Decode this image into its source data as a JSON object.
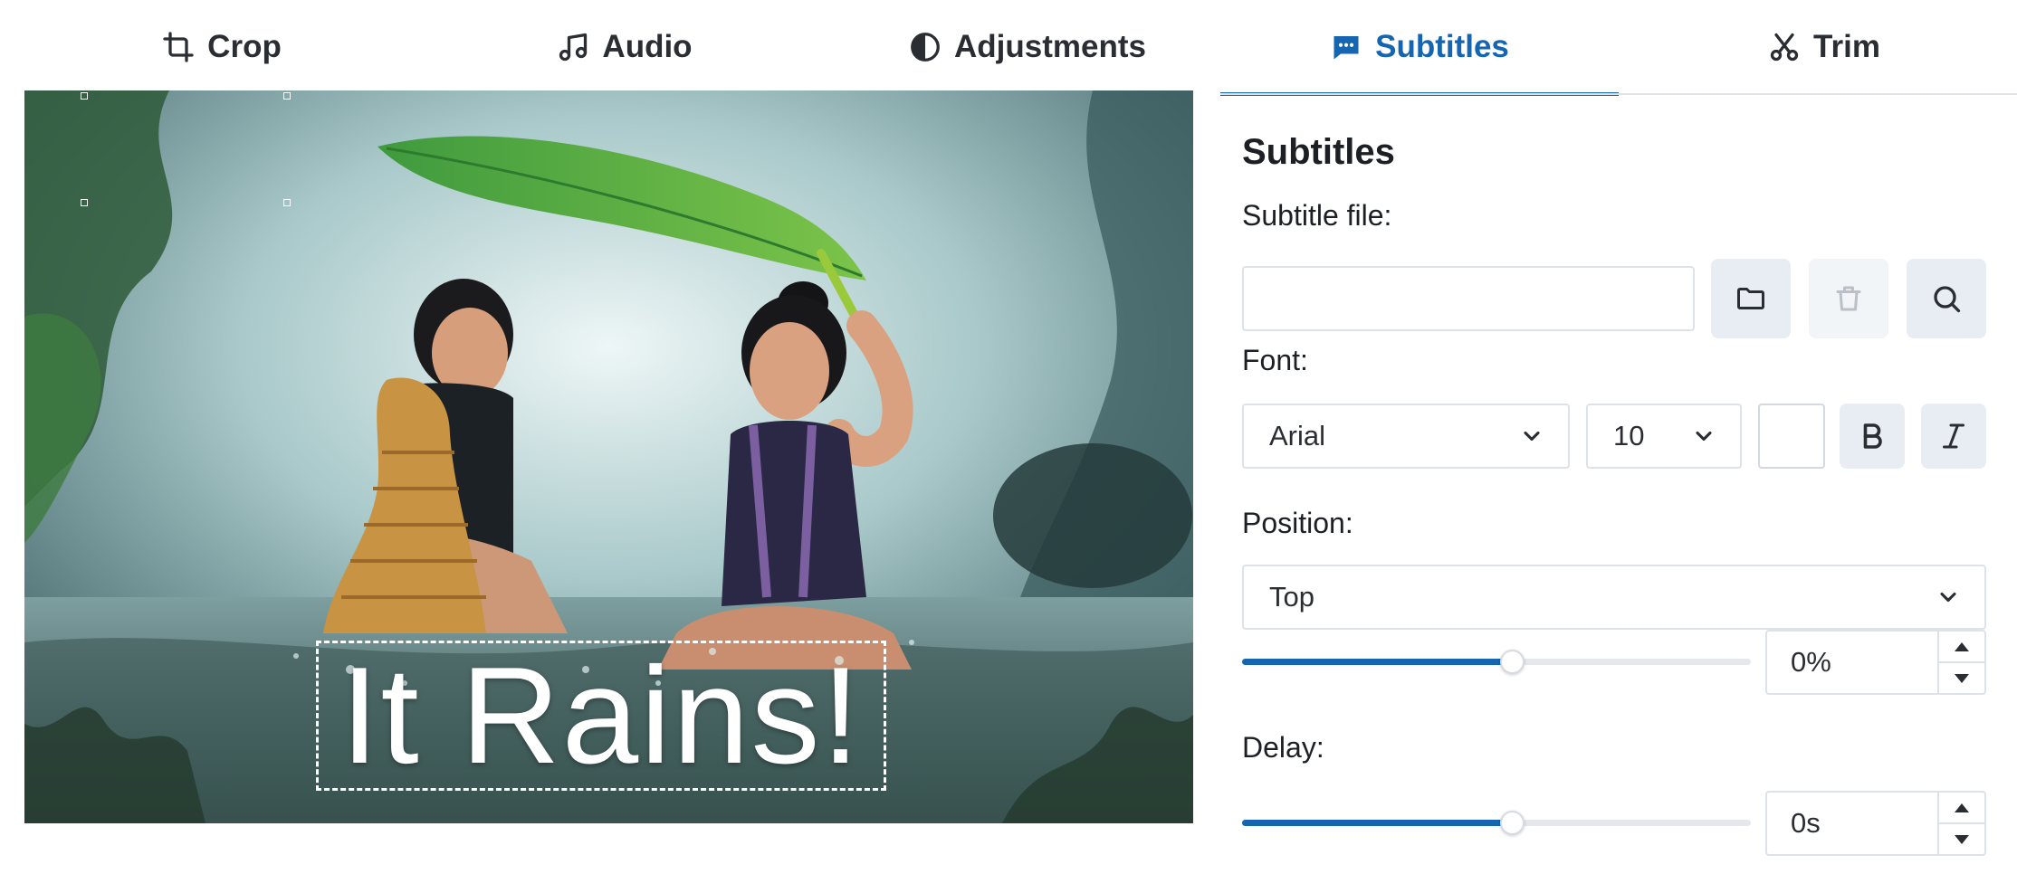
{
  "tabs": [
    {
      "id": "crop",
      "label": "Crop",
      "icon": "crop-icon"
    },
    {
      "id": "audio",
      "label": "Audio",
      "icon": "music-note-icon"
    },
    {
      "id": "adjustments",
      "label": "Adjustments",
      "icon": "contrast-icon"
    },
    {
      "id": "subtitles",
      "label": "Subtitles",
      "icon": "chat-bubble-icon",
      "active": true
    },
    {
      "id": "trim",
      "label": "Trim",
      "icon": "scissors-icon"
    }
  ],
  "preview": {
    "subtitle_text": "It Rains!"
  },
  "panel": {
    "title": "Subtitles",
    "subtitle_file_label": "Subtitle file:",
    "subtitle_file_value": "",
    "buttons": {
      "open": "folder-icon",
      "delete": "trash-icon",
      "preview": "search-icon"
    },
    "font_label": "Font:",
    "font_family_value": "Arial",
    "font_size_value": "10",
    "font_color": "#ffffff",
    "bold_icon": "bold-icon",
    "italic_icon": "italic-icon",
    "position_label": "Position:",
    "position_value": "Top",
    "position_offset_value": "0%",
    "position_slider_fraction": 0.53,
    "delay_label": "Delay:",
    "delay_value": "0s",
    "delay_slider_fraction": 0.53
  },
  "colors": {
    "accent": "#1565b0",
    "button_bg": "#e8edf3",
    "border": "#dde2e7"
  }
}
